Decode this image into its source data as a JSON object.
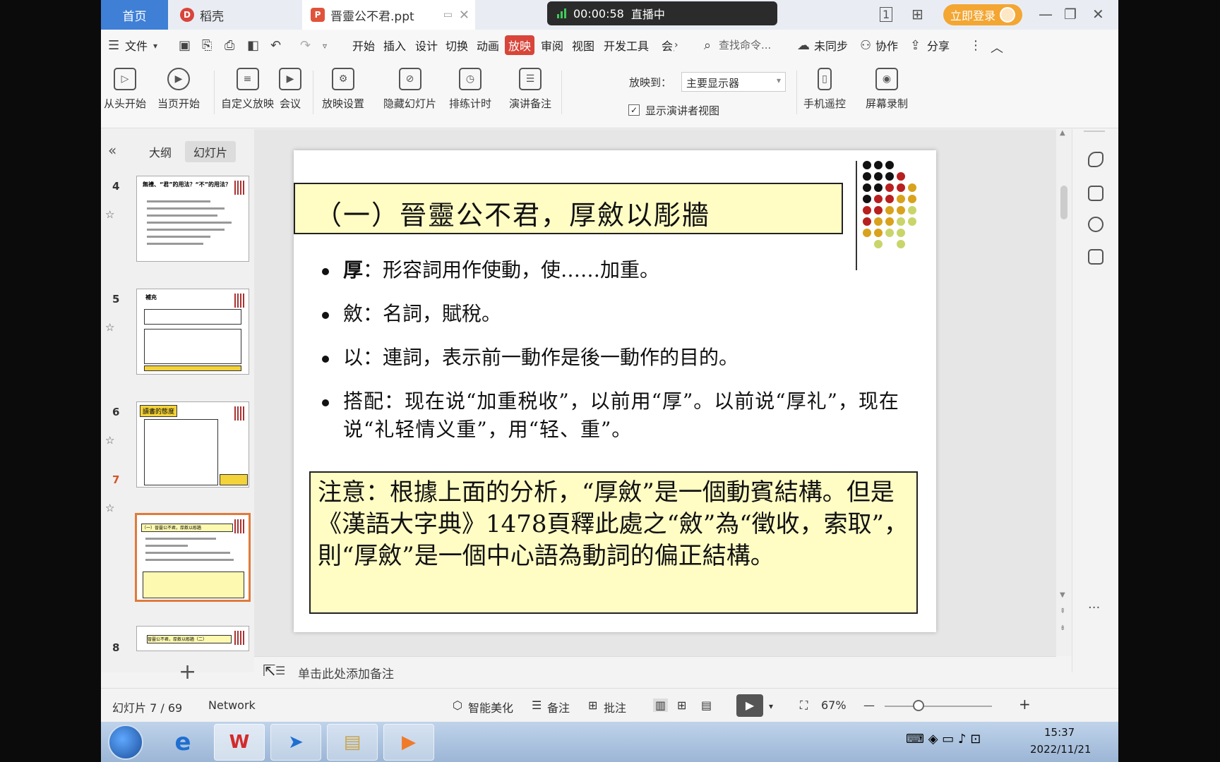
{
  "titlebar": {
    "tab_home": "首页",
    "tab_daoke": "稻壳",
    "tab_file": "晋靈公不君.ppt",
    "live_timer": "00:00:58",
    "live_status": "直播中",
    "login": "立即登录"
  },
  "menu": {
    "file": "文件",
    "tabs": [
      "开始",
      "插入",
      "设计",
      "切换",
      "动画",
      "放映",
      "审阅",
      "视图",
      "开发工具",
      "会员"
    ],
    "active_tab": "放映",
    "search_placeholder": "查找命令...",
    "sync": "未同步",
    "collab": "协作",
    "share": "分享"
  },
  "ribbon": {
    "from_start": "从头开始",
    "from_current": "当页开始",
    "custom": "自定义放映",
    "meeting": "会议",
    "settings": "放映设置",
    "hide_slide": "隐藏幻灯片",
    "rehearse": "排练计时",
    "speaker_notes": "演讲备注",
    "show_on_label": "放映到：",
    "show_on_value": "主要显示器",
    "presenter_view": "显示演讲者视图",
    "phone_remote": "手机遥控",
    "screen_record": "屏幕录制"
  },
  "left_panel": {
    "tab_outline": "大纲",
    "tab_slides": "幻灯片",
    "thumbnails": [
      {
        "num": "4",
        "title": "無禮、“君”的用法？“不”的用法？"
      },
      {
        "num": "5",
        "title": "補充"
      },
      {
        "num": "6",
        "title": "讀書的態度"
      },
      {
        "num": "7",
        "title": "（一）晉靈公不君，厚斂以彫牆"
      },
      {
        "num": "8",
        "title": "晉靈公不君，厚斂以彫牆（二）"
      }
    ],
    "selected": "7"
  },
  "slide": {
    "title": "（一）晉靈公不君，厚斂以彫牆",
    "bullets": [
      {
        "head": "厚",
        "text": "：形容詞用作使動，使……加重。"
      },
      {
        "head": "斂",
        "text": "：名詞，賦稅。"
      },
      {
        "head": "以",
        "text": "：連詞，表示前一動作是後一動作的目的。"
      },
      {
        "head": "搭配",
        "text": "：现在说“加重税收”，以前用“厚”。以前说“厚礼”，现在说“礼轻情义重”，用“轻、重”。"
      }
    ],
    "note": "注意：根據上面的分析，“厚斂”是一個動賓結構。但是《漢語大字典》1478頁釋此處之“斂”為“徵收，索取”，則“厚斂”是一個中心語為動詞的偏正結構。"
  },
  "notes_bar": "单击此处添加备注",
  "status": {
    "slide_counter": "幻灯片 7 / 69",
    "network": "Network",
    "beautify": "智能美化",
    "notes": "备注",
    "comments": "批注",
    "zoom": "67%"
  },
  "taskbar": {
    "time": "15:37",
    "date": "2022/11/21"
  },
  "colors": {
    "accent_blue": "#3f7fd6",
    "active_red": "#d9453a",
    "slide_yellow": "#fffdc4",
    "selection_orange": "#e07a3a"
  }
}
